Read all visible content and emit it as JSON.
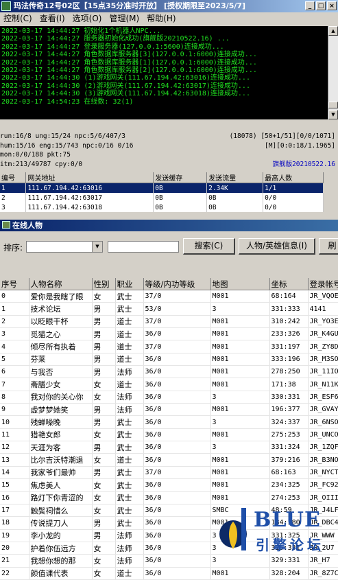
{
  "window": {
    "title": "玛法传奇12号02区【15点35分准时开放】 [授权期限至2023/5/7]",
    "buttons": [
      "_",
      "□",
      "×"
    ]
  },
  "menu": [
    "控制(C)",
    "查看(I)",
    "选项(O)",
    "管理(M)",
    "帮助(H)"
  ],
  "log": [
    "2022-03-17 14:44:27 初始化1个机器人NPC...",
    "2022-03-17 14:44:27 服务器初始化成功(旗舰版20210522.16) ...",
    "2022-03-17 14:44:27 登录服务器(127.0.0.1:5600)连接成功...",
    "2022-03-17 14:44:27 角色数据库服务器[3](127.0.0.1:6000)连接成功...",
    "2022-03-17 14:44:27 角色数据库服务器[1](127.0.0.1:6000)连接成功...",
    "2022-03-17 14:44:27 角色数据库服务器[2](127.0.0.1:6000)连接成功...",
    "2022-03-17 14:44:30 (1)游戏网关(111.67.194.42:63016)连接成功...",
    "2022-03-17 14:44:30 (2)游戏网关(111.67.194.42:63017)连接成功...",
    "2022-03-17 14:44:30 (3)游戏网关(111.67.194.42:63018)连接成功...",
    "2022-03-17 14:54:23 在线数: 32(1)"
  ],
  "stats": {
    "line1_left": "run:16/8 ung:15/24 npc:5/6/407/3",
    "line1_right": "(18078) [50+1/51][0/0/1071]",
    "line2_left": "hum:15/16 eng:15/743 npc:0/16 0/16",
    "line2_right": "[M][0:0:18/1.1965]",
    "line3_left": "mon:0/0/188 pkt:75",
    "line4_left": "itm:213/49787 cpy:0/0",
    "version": "旗舰版20210522.16"
  },
  "gateway_table": {
    "headers": [
      "编号",
      "网关地址",
      "发送缓存",
      "发送流量",
      "最高人数"
    ],
    "rows": [
      [
        "1",
        "111.67.194.42:63016",
        "0B",
        "2.34K",
        "1/1"
      ],
      [
        "2",
        "111.67.194.42:63017",
        "0B",
        "0B",
        "0/0"
      ],
      [
        "3",
        "111.67.194.42:63018",
        "0B",
        "0B",
        "0/0"
      ]
    ]
  },
  "online_panel": {
    "title": "在线人物",
    "sort_label": "排序:",
    "search_button": "搜索(C)",
    "info_button": "人物/英雄信息(I)",
    "refresh_button": "刷"
  },
  "players_table": {
    "headers": [
      "序号",
      "人物名称",
      "性别",
      "职业",
      "等级/内功等级",
      "地图",
      "坐标",
      "登录帐号"
    ],
    "rows": [
      [
        "0",
        "爱你是我瞎了眼",
        "女",
        "武士",
        "37/0",
        "M001",
        "68:164",
        "JR_VQOE"
      ],
      [
        "1",
        "技术论坛",
        "男",
        "武士",
        "53/0",
        "3",
        "331:333",
        "4141"
      ],
      [
        "2",
        "以眨眼干杯",
        "男",
        "道士",
        "37/0",
        "M001",
        "310:242",
        "JR_YO3E"
      ],
      [
        "3",
        "觅猫之心",
        "男",
        "道士",
        "36/0",
        "M001",
        "233:326",
        "JR_K4GU"
      ],
      [
        "4",
        "倾尽所有执着",
        "男",
        "道士",
        "37/0",
        "M001",
        "331:197",
        "JR_ZY8D"
      ],
      [
        "5",
        "芬莱",
        "男",
        "道士",
        "36/0",
        "M001",
        "333:196",
        "JR_M3SO"
      ],
      [
        "6",
        "与我否",
        "男",
        "法师",
        "36/0",
        "M001",
        "278:250",
        "JR_11IO"
      ],
      [
        "7",
        "斋膳少女",
        "女",
        "道士",
        "36/0",
        "M001",
        "171:38",
        "JR_N11K"
      ],
      [
        "8",
        "我对你的关心你",
        "女",
        "法师",
        "36/0",
        "3",
        "330:331",
        "JR_ESF6"
      ],
      [
        "9",
        "虚梦梦她笑",
        "男",
        "法师",
        "36/0",
        "M001",
        "196:377",
        "JR_GVAY"
      ],
      [
        "10",
        "残蝉噪晚",
        "男",
        "武士",
        "36/0",
        "3",
        "324:337",
        "JR_6NSO"
      ],
      [
        "11",
        "猎艳女郎",
        "女",
        "武士",
        "36/0",
        "M001",
        "275:253",
        "JR_UNCO"
      ],
      [
        "12",
        "天涯为客",
        "男",
        "武士",
        "36/0",
        "3",
        "331:324",
        "JR_1ZQF"
      ],
      [
        "13",
        "比尔吉沃特潮退",
        "女",
        "道士",
        "36/0",
        "M001",
        "379:216",
        "JR_B3NO"
      ],
      [
        "14",
        "我家爷们最帅",
        "男",
        "武士",
        "37/0",
        "M001",
        "68:163",
        "JR_NYCT"
      ],
      [
        "15",
        "焦虑美人",
        "女",
        "武士",
        "36/0",
        "M001",
        "234:325",
        "JR_FC92"
      ],
      [
        "16",
        "路灯下你青涩的",
        "女",
        "武士",
        "36/0",
        "M001",
        "274:253",
        "JR_OIII"
      ],
      [
        "17",
        "触鬓祠惜么",
        "女",
        "武士",
        "36/0",
        "SMBC",
        "48:59",
        "JR_J4LF"
      ],
      [
        "18",
        "传说提刀人",
        "男",
        "武士",
        "36/0",
        "M001",
        "184:380",
        "JR_DBC4"
      ],
      [
        "19",
        "李小龙的",
        "男",
        "法师",
        "36/0",
        "3",
        "331:325",
        "JR_WWW"
      ],
      [
        "20",
        "护着你伍远方",
        "女",
        "法师",
        "36/0",
        "3",
        "325:331",
        "JR_2U7"
      ],
      [
        "21",
        "我想你想的那",
        "女",
        "法师",
        "36/0",
        "3",
        "329:331",
        "JR_H7"
      ],
      [
        "22",
        "颜值课代表",
        "女",
        "道士",
        "36/0",
        "M001",
        "328:204",
        "JR_8Z7C"
      ]
    ]
  },
  "watermark": {
    "text": "BLUE",
    "subtext": "引擎论坛"
  }
}
